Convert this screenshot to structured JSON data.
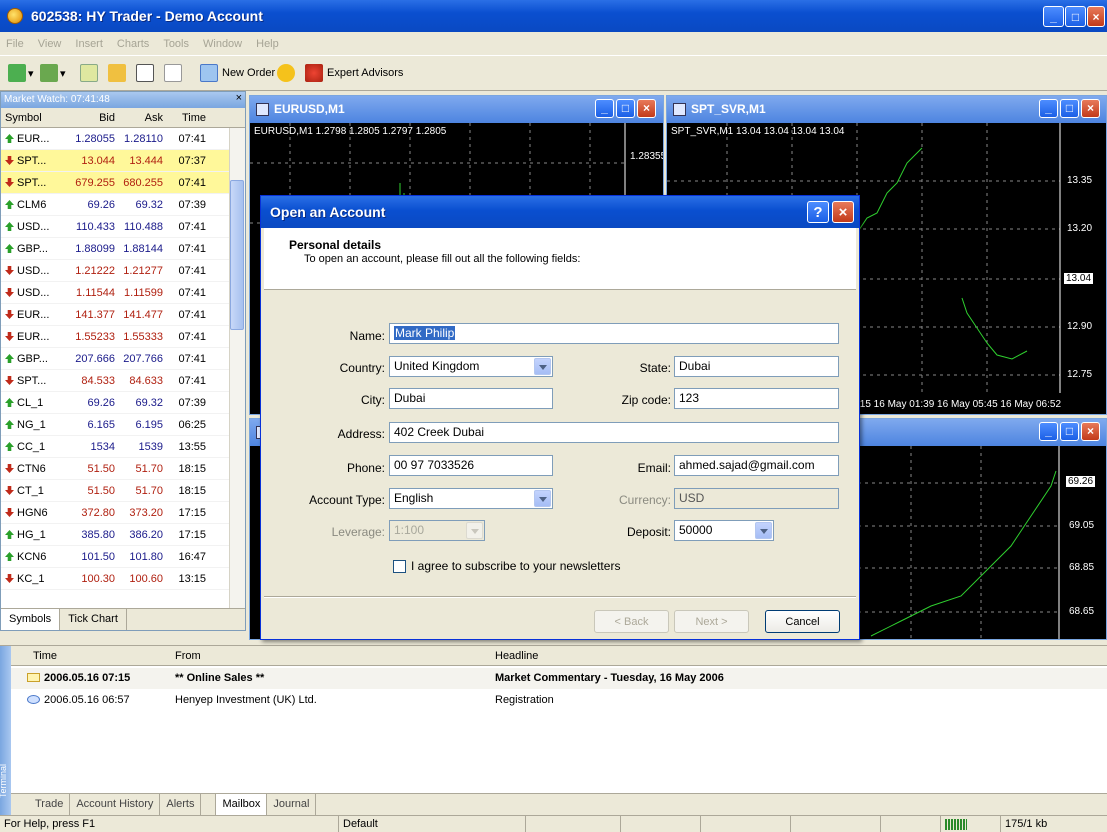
{
  "window": {
    "title": "602538: HY Trader - Demo Account"
  },
  "menu": [
    "File",
    "View",
    "Insert",
    "Charts",
    "Tools",
    "Window",
    "Help"
  ],
  "toolbar": {
    "new_order": "New Order",
    "expert_advisors": "Expert Advisors"
  },
  "market_watch": {
    "title": "Market Watch: 07:41:48",
    "columns": [
      "Symbol",
      "Bid",
      "Ask",
      "Time"
    ],
    "rows": [
      {
        "symbol": "EUR...",
        "bid": "1.28055",
        "ask": "1.28110",
        "time": "07:41",
        "dir": "up"
      },
      {
        "symbol": "SPT...",
        "bid": "13.044",
        "ask": "13.444",
        "time": "07:37",
        "dir": "down",
        "highlight": true
      },
      {
        "symbol": "SPT...",
        "bid": "679.255",
        "ask": "680.255",
        "time": "07:41",
        "dir": "down",
        "highlight": true
      },
      {
        "symbol": "CLM6",
        "bid": "69.26",
        "ask": "69.32",
        "time": "07:39",
        "dir": "up"
      },
      {
        "symbol": "USD...",
        "bid": "110.433",
        "ask": "110.488",
        "time": "07:41",
        "dir": "up"
      },
      {
        "symbol": "GBP...",
        "bid": "1.88099",
        "ask": "1.88144",
        "time": "07:41",
        "dir": "up"
      },
      {
        "symbol": "USD...",
        "bid": "1.21222",
        "ask": "1.21277",
        "time": "07:41",
        "dir": "down"
      },
      {
        "symbol": "USD...",
        "bid": "1.11544",
        "ask": "1.11599",
        "time": "07:41",
        "dir": "down"
      },
      {
        "symbol": "EUR...",
        "bid": "141.377",
        "ask": "141.477",
        "time": "07:41",
        "dir": "down"
      },
      {
        "symbol": "EUR...",
        "bid": "1.55233",
        "ask": "1.55333",
        "time": "07:41",
        "dir": "down"
      },
      {
        "symbol": "GBP...",
        "bid": "207.666",
        "ask": "207.766",
        "time": "07:41",
        "dir": "up"
      },
      {
        "symbol": "SPT...",
        "bid": "84.533",
        "ask": "84.633",
        "time": "07:41",
        "dir": "down"
      },
      {
        "symbol": "CL_1",
        "bid": "69.26",
        "ask": "69.32",
        "time": "07:39",
        "dir": "up"
      },
      {
        "symbol": "NG_1",
        "bid": "6.165",
        "ask": "6.195",
        "time": "06:25",
        "dir": "up"
      },
      {
        "symbol": "CC_1",
        "bid": "1534",
        "ask": "1539",
        "time": "13:55",
        "dir": "up"
      },
      {
        "symbol": "CTN6",
        "bid": "51.50",
        "ask": "51.70",
        "time": "18:15",
        "dir": "down"
      },
      {
        "symbol": "CT_1",
        "bid": "51.50",
        "ask": "51.70",
        "time": "18:15",
        "dir": "down"
      },
      {
        "symbol": "HGN6",
        "bid": "372.80",
        "ask": "373.20",
        "time": "17:15",
        "dir": "down"
      },
      {
        "symbol": "HG_1",
        "bid": "385.80",
        "ask": "386.20",
        "time": "17:15",
        "dir": "up"
      },
      {
        "symbol": "KCN6",
        "bid": "101.50",
        "ask": "101.80",
        "time": "16:47",
        "dir": "up"
      },
      {
        "symbol": "KC_1",
        "bid": "100.30",
        "ask": "100.60",
        "time": "13:15",
        "dir": "down"
      }
    ],
    "tabs": [
      "Symbols",
      "Tick Chart"
    ]
  },
  "charts": {
    "eurusd": {
      "title": "EURUSD,M1",
      "label": "EURUSD,M1 1.2798 1.2805 1.2797 1.2805",
      "price": "1.28355"
    },
    "spt_svr": {
      "title": "SPT_SVR,M1",
      "label": "SPT_SVR,M1 13.04 13.04 13.04 13.04",
      "prices": [
        "13.35",
        "13.20",
        "13.04",
        "12.90",
        "12.75"
      ],
      "time_axis": ":15  16 May 01:39  16 May 05:45  16 May 06:52"
    },
    "third": {
      "prices": [
        "69.26",
        "69.05",
        "68.85",
        "68.65"
      ]
    }
  },
  "dialog": {
    "title": "Open an Account",
    "heading": "Personal details",
    "subheading": "To open an account, please fill out all the following fields:",
    "labels": {
      "name": "Name:",
      "country": "Country:",
      "state": "State:",
      "city": "City:",
      "zip": "Zip code:",
      "address": "Address:",
      "phone": "Phone:",
      "email": "Email:",
      "account_type": "Account Type:",
      "currency": "Currency:",
      "leverage": "Leverage:",
      "deposit": "Deposit:"
    },
    "values": {
      "name": "Mark Philip",
      "country": "United Kingdom",
      "state": "Dubai",
      "city": "Dubai",
      "zip": "123",
      "address": "402 Creek Dubai",
      "phone": "00 97 7033526",
      "email": "ahmed.sajad@gmail.com",
      "account_type": "English",
      "currency": "USD",
      "leverage": "1:100",
      "deposit": "50000"
    },
    "newsletter": "I agree to subscribe to your newsletters",
    "buttons": {
      "back": "< Back",
      "next": "Next >",
      "cancel": "Cancel"
    }
  },
  "terminal": {
    "side_label": "Terminal",
    "columns": [
      "Time",
      "From",
      "Headline"
    ],
    "rows": [
      {
        "time": "2006.05.16 07:15",
        "from": "** Online Sales **",
        "headline": "Market Commentary - Tuesday, 16 May 2006",
        "unread": true
      },
      {
        "time": "2006.05.16 06:57",
        "from": "Henyep Investment (UK) Ltd.",
        "headline": "Registration",
        "unread": false
      }
    ],
    "tabs": [
      "Trade",
      "Account History",
      "Alerts",
      "Mailbox",
      "Journal"
    ]
  },
  "status": {
    "help": "For Help, press F1",
    "profile": "Default",
    "traffic": "175/1 kb"
  }
}
